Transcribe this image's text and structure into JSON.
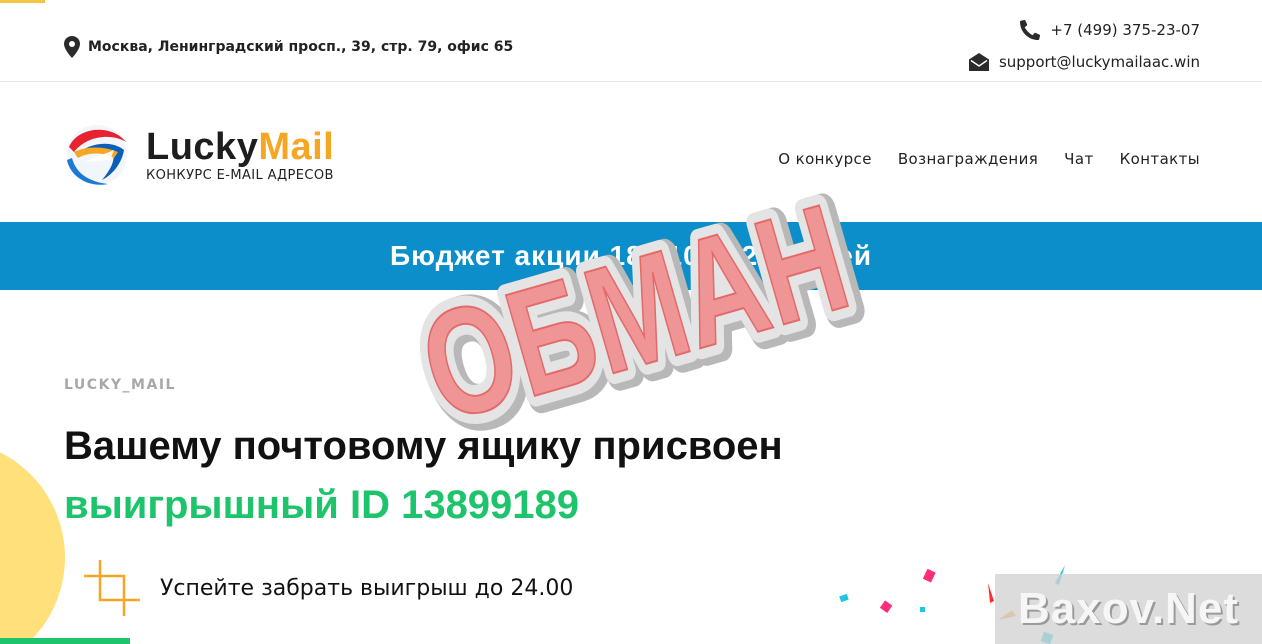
{
  "topbar": {
    "address": "Москва, Ленинградский просп., 39, стр. 79, офис 65",
    "phone": "+7 (499) 375-23-07",
    "email": "support@luckymailaac.win"
  },
  "header": {
    "brand_part1": "Lucky",
    "brand_part2": "Mail",
    "tagline": "КОНКУРС E-MAIL АДРЕСОВ",
    "nav": [
      "О конкурсе",
      "Вознаграждения",
      "Чат",
      "Контакты"
    ]
  },
  "banner": {
    "text": "Бюджет акции 18 110 962 рублей"
  },
  "main": {
    "eyebrow": "LUCKY_MAIL",
    "headline": "Вашему почтовому ящику присвоен",
    "headline_green": "выигрышный ID 13899189",
    "deadline_prefix": "Успейте забрать выигрыш до ",
    "deadline_time": "24.00"
  },
  "overlay": {
    "stamp_text": "ОБМАН",
    "watermark": "Baxov.Net"
  },
  "colors": {
    "accent_blue": "#0b8ec9",
    "accent_orange": "#f5a623",
    "accent_green": "#1ec46b",
    "stamp_red": "#f08a8a"
  },
  "icons": [
    "map-pin-icon",
    "phone-icon",
    "envelope-icon",
    "logo-globe-icon",
    "crop-icon"
  ]
}
